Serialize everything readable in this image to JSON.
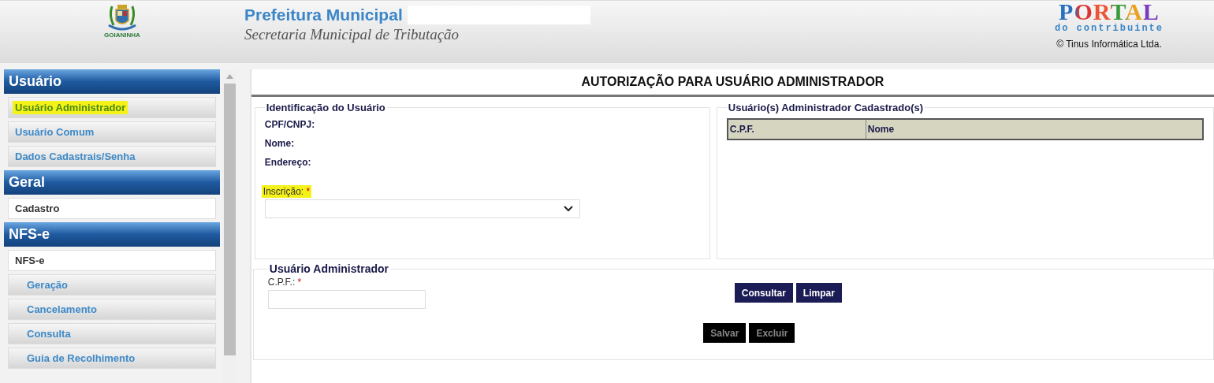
{
  "header": {
    "logo_caption": "GOIANINHA",
    "title": "Prefeitura Municipal",
    "subtitle": "Secretaria Municipal de Tributação",
    "portal": {
      "title": "PORTAL",
      "tagline": "do contribuinte",
      "copyright": "© Tinus Informática Ltda."
    }
  },
  "sidebar": {
    "sections": [
      {
        "title": "Usuário",
        "items": [
          {
            "label": "Usuário Administrador",
            "kind": "link",
            "selected": true
          },
          {
            "label": "Usuário Comum",
            "kind": "link",
            "selected": false
          },
          {
            "label": "Dados Cadastrais/Senha",
            "kind": "link",
            "selected": false
          }
        ]
      },
      {
        "title": "Geral",
        "items": [
          {
            "label": "Cadastro",
            "kind": "plain",
            "selected": false
          }
        ]
      },
      {
        "title": "NFS-e",
        "items": [
          {
            "label": "NFS-e",
            "kind": "plain",
            "selected": false,
            "children": [
              {
                "label": "Geração",
                "kind": "link",
                "selected": false
              },
              {
                "label": "Cancelamento",
                "kind": "link",
                "selected": false
              },
              {
                "label": "Consulta",
                "kind": "link",
                "selected": false
              },
              {
                "label": "Guia de Recolhimento",
                "kind": "link",
                "selected": false
              }
            ]
          }
        ]
      }
    ]
  },
  "page": {
    "title": "AUTORIZAÇÃO PARA USUÁRIO ADMINISTRADOR",
    "identification": {
      "legend": "Identificação do Usuário",
      "fields": [
        "CPF/CNPJ:",
        "Nome:",
        "Endereço:"
      ],
      "inscricao": {
        "label": "Inscrição:",
        "required_mark": "*",
        "highlighted": true
      }
    },
    "registered": {
      "legend": "Usuário(s) Administrador Cadastrado(s)",
      "columns": [
        "C.P.F.",
        "Nome"
      ]
    },
    "admin": {
      "legend": "Usuário Administrador",
      "cpf": {
        "label": "C.P.F.:",
        "required_mark": "*"
      },
      "buttons": [
        {
          "label": "Consultar",
          "disabled": false
        },
        {
          "label": "Limpar",
          "disabled": false
        }
      ],
      "actions": [
        {
          "label": "Salvar",
          "disabled": true
        },
        {
          "label": "Excluir",
          "disabled": true
        }
      ]
    }
  }
}
